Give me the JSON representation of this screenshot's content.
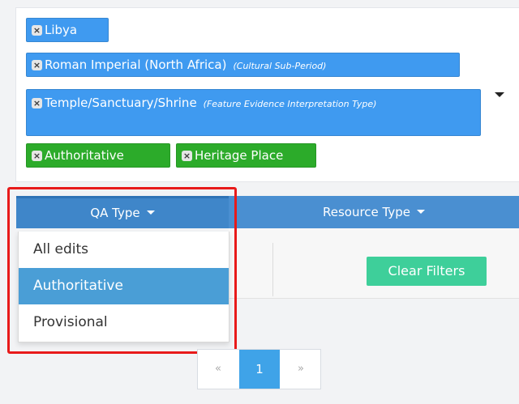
{
  "tags": [
    {
      "label": "Libya",
      "note": "",
      "color": "blue"
    },
    {
      "label": "Roman Imperial (North Africa)",
      "note": "(Cultural Sub-Period)",
      "color": "blue"
    },
    {
      "label": "Temple/Sanctuary/Shrine",
      "note": "(Feature Evidence Interpretation Type)",
      "color": "blue"
    },
    {
      "label": "Authoritative",
      "note": "",
      "color": "green"
    },
    {
      "label": "Heritage Place",
      "note": "",
      "color": "green"
    }
  ],
  "remove_glyph": "×",
  "filter_bar": {
    "qa_type": "QA Type",
    "resource_type": "Resource Type"
  },
  "qa_menu": [
    "All edits",
    "Authoritative",
    "Provisional"
  ],
  "qa_selected": "Authoritative",
  "clear_filters": "Clear Filters",
  "pagination": {
    "prev": "«",
    "current": "1",
    "next": "»"
  },
  "colors": {
    "tag_blue": "#3f9af0",
    "tag_green": "#2cab2a",
    "bar": "#4a8fd1",
    "selected": "#4a9ed6",
    "clear_btn": "#3ecf9a",
    "highlight": "#e81a1a"
  }
}
